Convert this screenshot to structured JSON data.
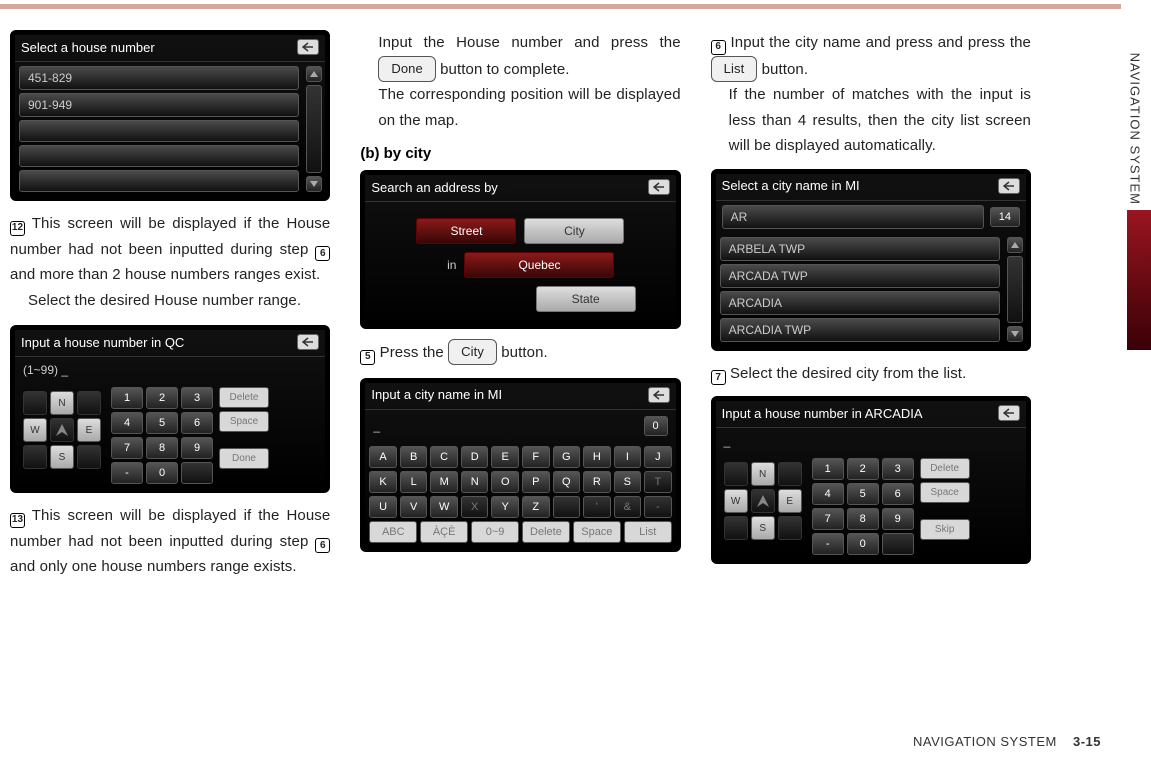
{
  "footer": {
    "section": "NAVIGATION SYSTEM",
    "page": "3-15"
  },
  "side_label": "NAVIGATION SYSTEM",
  "col1": {
    "shot1": {
      "title": "Select a house number",
      "rows": [
        "451-829",
        "901-949",
        "",
        "",
        ""
      ]
    },
    "step12": "12",
    "p1a": "This screen will be displayed if the House number had not been inputted during step ",
    "ref6": "6",
    "p1b": " and more than 2 house numbers ranges exist.",
    "p1c": "Select the desired House number range.",
    "shot2": {
      "title": "Input a house number in QC",
      "input": "(1~99) _",
      "compass": [
        "",
        "N",
        "",
        "W",
        "",
        "E",
        "",
        "S",
        ""
      ],
      "numpad": [
        "1",
        "2",
        "3",
        "4",
        "5",
        "6",
        "7",
        "8",
        "9",
        "-",
        "0",
        ""
      ],
      "actions": [
        "Delete",
        "Space",
        "",
        "Done"
      ]
    },
    "step13": "13",
    "p2a": "This screen will be displayed if the House number had not been inputted during step ",
    "p2b": " and only one house numbers range exists."
  },
  "col2": {
    "p1a": "Input the House number and press the ",
    "btn_done": "Done",
    "p1b": " button to complete.",
    "p1c": "The corresponding position will be displayed on the map.",
    "subhead": "(b) by city",
    "shot1": {
      "title": "Search an address by",
      "street": "Street",
      "city": "City",
      "in": "in",
      "state_val": "Quebec",
      "state": "State"
    },
    "step5": "5",
    "p2a": "Press the ",
    "btn_city": "City",
    "p2b": " button.",
    "shot2": {
      "title": "Input a city name in MI",
      "input": "_",
      "count": "0",
      "rows": [
        [
          "A",
          "B",
          "C",
          "D",
          "E",
          "F",
          "G",
          "H",
          "I",
          "J"
        ],
        [
          "K",
          "L",
          "M",
          "N",
          "O",
          "P",
          "Q",
          "R",
          "S",
          "T"
        ],
        [
          "U",
          "V",
          "W",
          "X",
          "Y",
          "Z",
          "",
          "'",
          "&",
          "-"
        ]
      ],
      "bottom": [
        "ABC",
        "ÀÇÈ",
        "0~9",
        "Delete",
        "Space",
        "List"
      ]
    }
  },
  "col3": {
    "step6": "6",
    "p1a": "Input the city name and press and press the ",
    "btn_list": "List",
    "p1b": " button.",
    "p1c": "If the number of matches with the input is less than 4 results, then the city list screen will be displayed automatically.",
    "shot1": {
      "title": "Select a city name in MI",
      "search": "AR",
      "count": "14",
      "rows": [
        "ARBELA TWP",
        "ARCADA TWP",
        "ARCADIA",
        "ARCADIA TWP"
      ]
    },
    "step7": "7",
    "p2": "Select the desired city from the list.",
    "shot2": {
      "title": "Input a house number in ARCADIA",
      "input": "_",
      "compass": [
        "",
        "N",
        "",
        "W",
        "",
        "E",
        "",
        "S",
        ""
      ],
      "numpad": [
        "1",
        "2",
        "3",
        "4",
        "5",
        "6",
        "7",
        "8",
        "9",
        "-",
        "0",
        ""
      ],
      "actions": [
        "Delete",
        "Space",
        "",
        "Skip"
      ]
    }
  }
}
